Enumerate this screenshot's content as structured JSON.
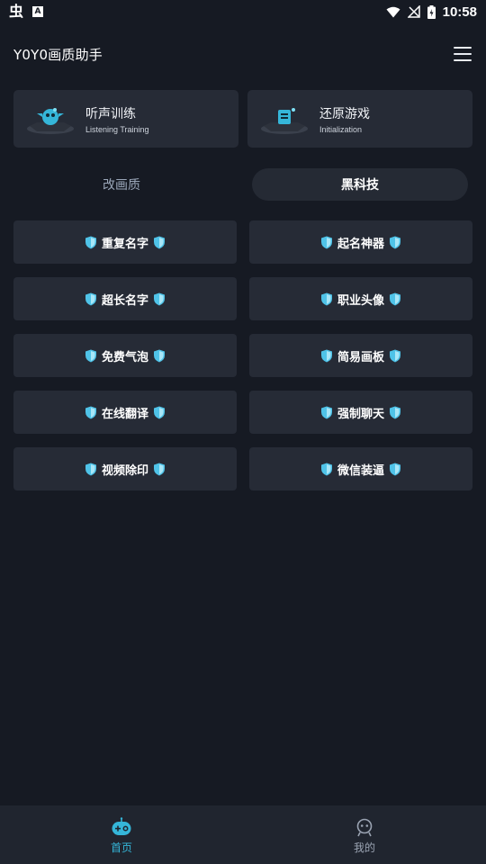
{
  "status_bar": {
    "left_glyph": "虫",
    "left_box": "A",
    "time": "10:58"
  },
  "header": {
    "title": "Y0Y0画质助手"
  },
  "features": [
    {
      "title": "听声训练",
      "subtitle": "Listening Training",
      "icon": "bird-robot-icon"
    },
    {
      "title": "还原游戏",
      "subtitle": "Initialization",
      "icon": "restore-box-icon"
    }
  ],
  "tabs": [
    {
      "label": "改画质",
      "active": false
    },
    {
      "label": "黑科技",
      "active": true
    }
  ],
  "tools": [
    {
      "label": "重复名字"
    },
    {
      "label": "起名神器"
    },
    {
      "label": "超长名字"
    },
    {
      "label": "职业头像"
    },
    {
      "label": "免费气泡"
    },
    {
      "label": "简易画板"
    },
    {
      "label": "在线翻译"
    },
    {
      "label": "强制聊天"
    },
    {
      "label": "视频除印"
    },
    {
      "label": "微信装逼"
    }
  ],
  "bottom_nav": [
    {
      "label": "首页",
      "icon": "gamepad-icon",
      "active": true
    },
    {
      "label": "我的",
      "icon": "robot-profile-icon",
      "active": false
    }
  ],
  "colors": {
    "background": "#161a23",
    "card": "#262b36",
    "accent": "#35b6d9",
    "shield": "#4fc3e8"
  }
}
